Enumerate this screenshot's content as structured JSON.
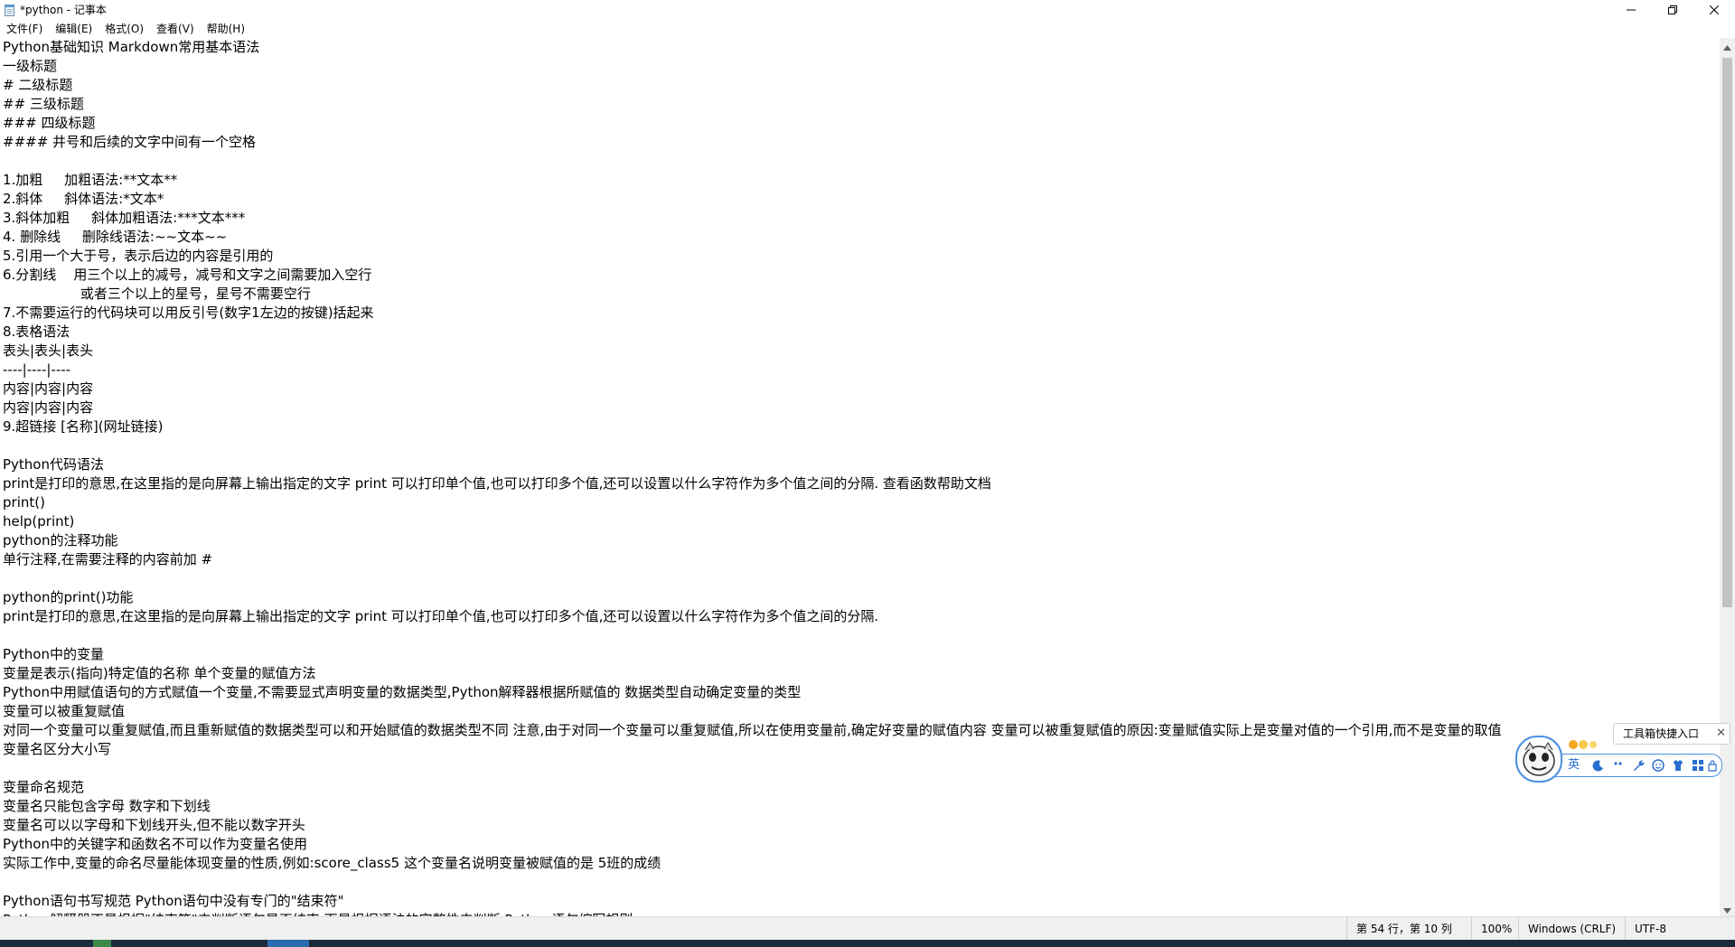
{
  "window": {
    "title": "*python - 记事本"
  },
  "menu": {
    "items": [
      "文件(F)",
      "编辑(E)",
      "格式(O)",
      "查看(V)",
      "帮助(H)"
    ]
  },
  "editor": {
    "lines": [
      "Python基础知识 Markdown常用基本语法",
      "一级标题",
      "# 二级标题",
      "## 三级标题",
      "### 四级标题",
      "#### 井号和后续的文字中间有一个空格",
      "",
      "1.加粗     加粗语法:**文本**",
      "2.斜体     斜体语法:*文本*",
      "3.斜体加粗     斜体加粗语法:***文本***",
      "4. 删除线     删除线语法:~~文本~~",
      "5.引用一个大于号，表示后边的内容是引用的",
      "6.分割线    用三个以上的减号，减号和文字之间需要加入空行",
      "                  或者三个以上的星号，星号不需要空行",
      "7.不需要运行的代码块可以用反引号(数字1左边的按键)括起来",
      "8.表格语法",
      "表头|表头|表头",
      "----|----|----",
      "内容|内容|内容",
      "内容|内容|内容",
      "9.超链接 [名称](网址链接)",
      "",
      "Python代码语法",
      "print是打印的意思,在这里指的是向屏幕上输出指定的文字 print 可以打印单个值,也可以打印多个值,还可以设置以什么字符作为多个值之间的分隔. 查看函数帮助文档",
      "print()",
      "help(print)",
      "python的注释功能",
      "单行注释,在需要注释的内容前加 #",
      "",
      "python的print()功能",
      "print是打印的意思,在这里指的是向屏幕上输出指定的文字 print 可以打印单个值,也可以打印多个值,还可以设置以什么字符作为多个值之间的分隔.",
      "",
      "Python中的变量",
      "变量是表示(指向)特定值的名称 单个变量的赋值方法",
      "Python中用赋值语句的方式赋值一个变量,不需要显式声明变量的数据类型,Python解释器根据所赋值的 数据类型自动确定变量的类型",
      "变量可以被重复赋值",
      "对同一个变量可以重复赋值,而且重新赋值的数据类型可以和开始赋值的数据类型不同 注意,由于对同一个变量可以重复赋值,所以在使用变量前,确定好变量的赋值内容 变量可以被重复赋值的原因:变量赋值实际上是变量对值的一个引用,而不是变量的取值",
      "变量名区分大小写",
      "",
      "变量命名规范",
      "变量名只能包含字母 数字和下划线",
      "变量名可以以字母和下划线开头,但不能以数字开头",
      "Python中的关键字和函数名不可以作为变量名使用",
      "实际工作中,变量的命名尽量能体现变量的性质,例如:score_class5 这个变量名说明变量被赋值的是 5班的成绩",
      "",
      "Python语句书写规范 Python语句中没有专门的\"结束符\"",
      "Python解释器不是根据\"结束符\"来判断语句是否结束,而是根据语法的完整性来判断 Python语句缩写规则"
    ]
  },
  "status": {
    "position": "第 54 行，第 10 列",
    "zoom": "100%",
    "line_ending": "Windows (CRLF)",
    "encoding": "UTF-8"
  },
  "ime": {
    "tip_label": "工具箱快捷入口",
    "tip_close": "✕",
    "language": "英"
  },
  "icons": {
    "app": "notepad-icon",
    "minimize": "minimize-icon",
    "maximize": "restore-icon",
    "close": "close-icon"
  },
  "colors": {
    "taskbar": "#1b2b3a",
    "ime_accent": "#4a8fe0"
  }
}
